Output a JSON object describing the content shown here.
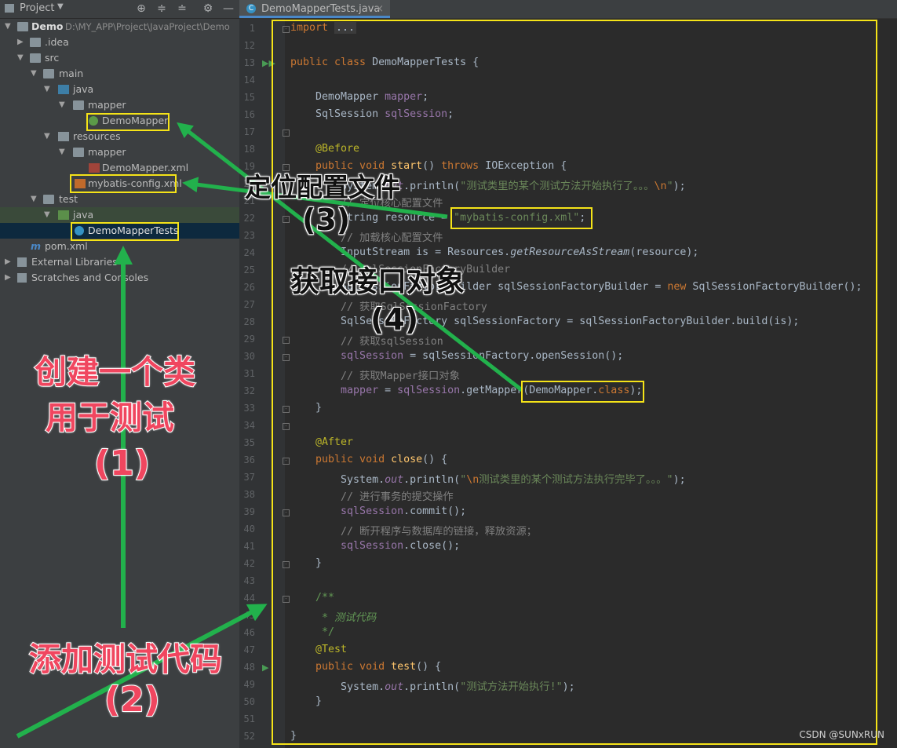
{
  "project_panel": {
    "title": "Project",
    "tree": [
      {
        "label": "Demo",
        "path": "D:\\MY_APP\\Project\\JavaProject\\Demo"
      },
      {
        "label": ".idea"
      },
      {
        "label": "src"
      },
      {
        "label": "main"
      },
      {
        "label": "java"
      },
      {
        "label": "mapper"
      },
      {
        "label": "DemoMapper"
      },
      {
        "label": "resources"
      },
      {
        "label": "mapper"
      },
      {
        "label": "DemoMapper.xml"
      },
      {
        "label": "mybatis-config.xml"
      },
      {
        "label": "test"
      },
      {
        "label": "java"
      },
      {
        "label": "DemoMapperTests"
      },
      {
        "label": "pom.xml"
      },
      {
        "label": "External Libraries"
      },
      {
        "label": "Scratches and Consoles"
      }
    ]
  },
  "editor": {
    "tab_label": "DemoMapperTests.java",
    "tab_close": "×",
    "line_numbers": [
      "1",
      "12",
      "13",
      "14",
      "15",
      "16",
      "17",
      "18",
      "19",
      "20",
      "21",
      "22",
      "23",
      "24",
      "25",
      "26",
      "27",
      "28",
      "29",
      "30",
      "31",
      "32",
      "33",
      "34",
      "35",
      "36",
      "37",
      "38",
      "39",
      "40",
      "41",
      "42",
      "43",
      "44",
      "45",
      "46",
      "47",
      "48",
      "49",
      "50",
      "51",
      "52"
    ]
  },
  "annotations": {
    "create_class": "创建一个类",
    "for_test": "用于测试",
    "step1": "(1)",
    "add_test_code": "添加测试代码",
    "step2": "(2)",
    "locate_config": "定位配置文件",
    "step3": "(3)",
    "get_interface": "获取接口对象",
    "step4": "(4)"
  },
  "watermark": "CSDN @SUNxRUN",
  "colors": {
    "highlight_box": "#f5e318",
    "arrow": "#22b14c",
    "annotation_red": "#f0465f"
  }
}
